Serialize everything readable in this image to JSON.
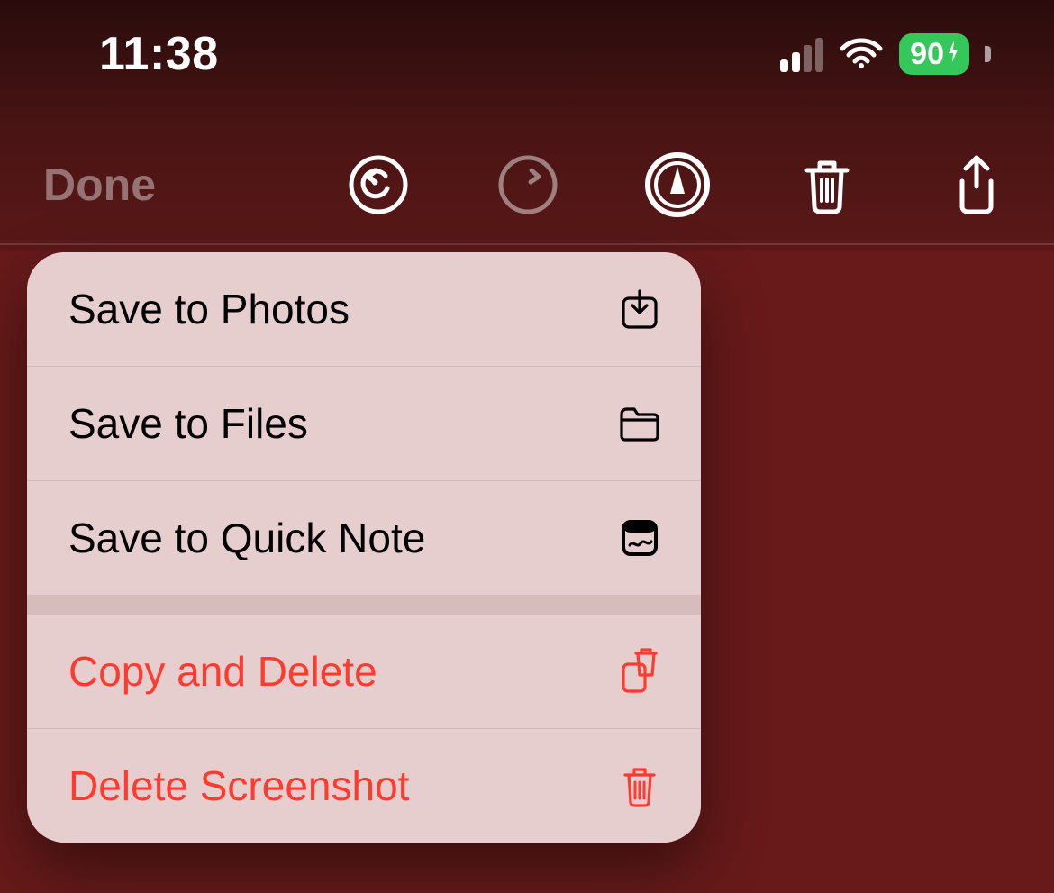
{
  "status": {
    "time": "11:38",
    "battery_pct": "90"
  },
  "toolbar": {
    "done_label": "Done"
  },
  "menu": {
    "save_photos": "Save to Photos",
    "save_files": "Save to Files",
    "save_quicknote": "Save to Quick Note",
    "copy_delete": "Copy and Delete",
    "delete_screenshot": "Delete Screenshot"
  }
}
